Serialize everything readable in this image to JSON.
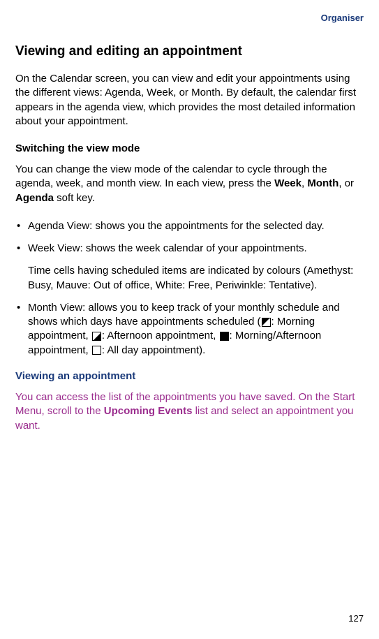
{
  "header": {
    "section": "Organiser"
  },
  "title": "Viewing and editing an appointment",
  "intro": "On the Calendar screen, you can view and edit your appointments using the different views: Agenda, Week, or Month. By default, the calendar first appears in the agenda view, which provides the most detailed information about your appointment.",
  "switching": {
    "heading": "Switching the view mode",
    "text_pre": "You can change the view mode of the calendar to cycle through the agenda, week, and month view. In each view, press the ",
    "week": "Week",
    "comma1": ", ",
    "month": "Month",
    "comma2": ", or ",
    "agenda": "Agenda",
    "text_post": " soft key."
  },
  "bullets": {
    "agenda": "Agenda View: shows you the appointments for the selected day.",
    "week": "Week View: shows the week calendar of your appointments.",
    "week_sub": "Time cells having scheduled items are indicated by colours (Amethyst: Busy, Mauve: Out of office, White: Free, Periwinkle: Tentative).",
    "month_pre": "Month View: allows you to keep track of your monthly schedule and shows which days have appointments scheduled (",
    "month_morning": ": Morning appointment, ",
    "month_afternoon": ": Afternoon appointment, ",
    "month_both": ": Morning/Afternoon appointment, ",
    "month_allday": ": All day appointment)."
  },
  "viewing": {
    "heading": "Viewing an appointment",
    "text_pre": "You can access the list of the appointments you have saved. On the Start Menu, scroll to the ",
    "upcoming": "Upcoming Events",
    "text_post": " list and select an appointment you want."
  },
  "page_number": "127"
}
